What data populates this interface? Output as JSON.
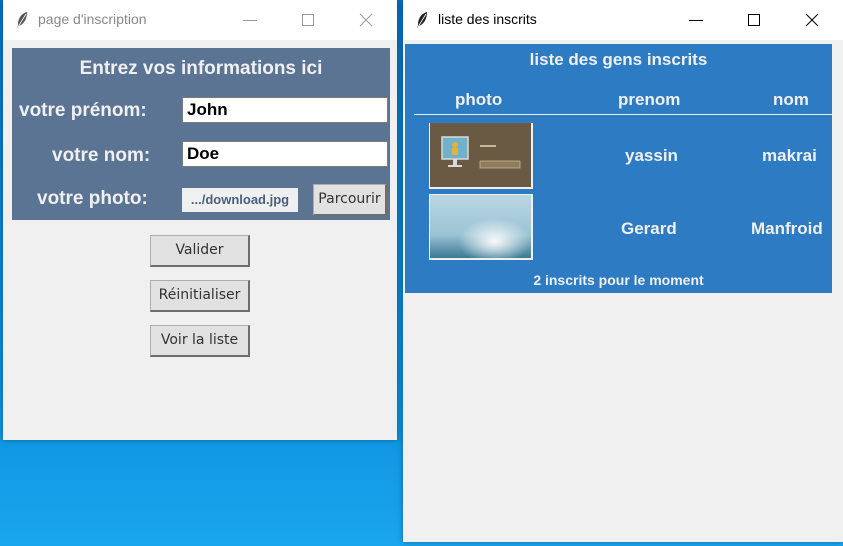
{
  "window_form": {
    "title": "page d'inscription",
    "heading": "Entrez vos informations ici",
    "first_name_label": "votre prénom:",
    "first_name_value": "John",
    "last_name_label": "votre nom:",
    "last_name_value": "Doe",
    "photo_label": "votre photo:",
    "photo_file": ".../download.jpg",
    "browse_label": "Parcourir",
    "validate_label": "Valider",
    "reset_label": "Réinitialiser",
    "show_list_label": "Voir la liste",
    "active": false
  },
  "window_list": {
    "title": "liste des inscrits",
    "heading": "liste des gens inscrits",
    "columns": [
      "photo",
      "prenom",
      "nom"
    ],
    "rows": [
      {
        "prenom": "yassin",
        "nom": "makrai",
        "photo_icon": "computer-screen-thumbnail"
      },
      {
        "prenom": "Gerard",
        "nom": "Manfroid",
        "photo_icon": "sea-horizon-thumbnail"
      }
    ],
    "footer": "2 inscrits pour le moment",
    "active": true
  },
  "colors": {
    "form_panel": "#5b7493",
    "list_panel": "#2d7bc2",
    "desktop": "#0b8fe0"
  }
}
